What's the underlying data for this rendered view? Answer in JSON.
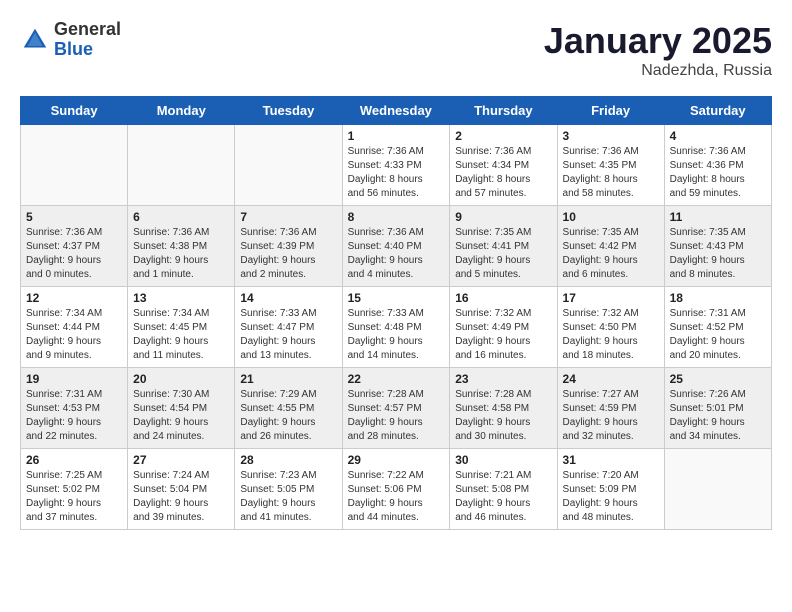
{
  "logo": {
    "general": "General",
    "blue": "Blue"
  },
  "title": "January 2025",
  "location": "Nadezhda, Russia",
  "days_of_week": [
    "Sunday",
    "Monday",
    "Tuesday",
    "Wednesday",
    "Thursday",
    "Friday",
    "Saturday"
  ],
  "weeks": [
    [
      {
        "day": "",
        "info": ""
      },
      {
        "day": "",
        "info": ""
      },
      {
        "day": "",
        "info": ""
      },
      {
        "day": "1",
        "info": "Sunrise: 7:36 AM\nSunset: 4:33 PM\nDaylight: 8 hours\nand 56 minutes."
      },
      {
        "day": "2",
        "info": "Sunrise: 7:36 AM\nSunset: 4:34 PM\nDaylight: 8 hours\nand 57 minutes."
      },
      {
        "day": "3",
        "info": "Sunrise: 7:36 AM\nSunset: 4:35 PM\nDaylight: 8 hours\nand 58 minutes."
      },
      {
        "day": "4",
        "info": "Sunrise: 7:36 AM\nSunset: 4:36 PM\nDaylight: 8 hours\nand 59 minutes."
      }
    ],
    [
      {
        "day": "5",
        "info": "Sunrise: 7:36 AM\nSunset: 4:37 PM\nDaylight: 9 hours\nand 0 minutes."
      },
      {
        "day": "6",
        "info": "Sunrise: 7:36 AM\nSunset: 4:38 PM\nDaylight: 9 hours\nand 1 minute."
      },
      {
        "day": "7",
        "info": "Sunrise: 7:36 AM\nSunset: 4:39 PM\nDaylight: 9 hours\nand 2 minutes."
      },
      {
        "day": "8",
        "info": "Sunrise: 7:36 AM\nSunset: 4:40 PM\nDaylight: 9 hours\nand 4 minutes."
      },
      {
        "day": "9",
        "info": "Sunrise: 7:35 AM\nSunset: 4:41 PM\nDaylight: 9 hours\nand 5 minutes."
      },
      {
        "day": "10",
        "info": "Sunrise: 7:35 AM\nSunset: 4:42 PM\nDaylight: 9 hours\nand 6 minutes."
      },
      {
        "day": "11",
        "info": "Sunrise: 7:35 AM\nSunset: 4:43 PM\nDaylight: 9 hours\nand 8 minutes."
      }
    ],
    [
      {
        "day": "12",
        "info": "Sunrise: 7:34 AM\nSunset: 4:44 PM\nDaylight: 9 hours\nand 9 minutes."
      },
      {
        "day": "13",
        "info": "Sunrise: 7:34 AM\nSunset: 4:45 PM\nDaylight: 9 hours\nand 11 minutes."
      },
      {
        "day": "14",
        "info": "Sunrise: 7:33 AM\nSunset: 4:47 PM\nDaylight: 9 hours\nand 13 minutes."
      },
      {
        "day": "15",
        "info": "Sunrise: 7:33 AM\nSunset: 4:48 PM\nDaylight: 9 hours\nand 14 minutes."
      },
      {
        "day": "16",
        "info": "Sunrise: 7:32 AM\nSunset: 4:49 PM\nDaylight: 9 hours\nand 16 minutes."
      },
      {
        "day": "17",
        "info": "Sunrise: 7:32 AM\nSunset: 4:50 PM\nDaylight: 9 hours\nand 18 minutes."
      },
      {
        "day": "18",
        "info": "Sunrise: 7:31 AM\nSunset: 4:52 PM\nDaylight: 9 hours\nand 20 minutes."
      }
    ],
    [
      {
        "day": "19",
        "info": "Sunrise: 7:31 AM\nSunset: 4:53 PM\nDaylight: 9 hours\nand 22 minutes."
      },
      {
        "day": "20",
        "info": "Sunrise: 7:30 AM\nSunset: 4:54 PM\nDaylight: 9 hours\nand 24 minutes."
      },
      {
        "day": "21",
        "info": "Sunrise: 7:29 AM\nSunset: 4:55 PM\nDaylight: 9 hours\nand 26 minutes."
      },
      {
        "day": "22",
        "info": "Sunrise: 7:28 AM\nSunset: 4:57 PM\nDaylight: 9 hours\nand 28 minutes."
      },
      {
        "day": "23",
        "info": "Sunrise: 7:28 AM\nSunset: 4:58 PM\nDaylight: 9 hours\nand 30 minutes."
      },
      {
        "day": "24",
        "info": "Sunrise: 7:27 AM\nSunset: 4:59 PM\nDaylight: 9 hours\nand 32 minutes."
      },
      {
        "day": "25",
        "info": "Sunrise: 7:26 AM\nSunset: 5:01 PM\nDaylight: 9 hours\nand 34 minutes."
      }
    ],
    [
      {
        "day": "26",
        "info": "Sunrise: 7:25 AM\nSunset: 5:02 PM\nDaylight: 9 hours\nand 37 minutes."
      },
      {
        "day": "27",
        "info": "Sunrise: 7:24 AM\nSunset: 5:04 PM\nDaylight: 9 hours\nand 39 minutes."
      },
      {
        "day": "28",
        "info": "Sunrise: 7:23 AM\nSunset: 5:05 PM\nDaylight: 9 hours\nand 41 minutes."
      },
      {
        "day": "29",
        "info": "Sunrise: 7:22 AM\nSunset: 5:06 PM\nDaylight: 9 hours\nand 44 minutes."
      },
      {
        "day": "30",
        "info": "Sunrise: 7:21 AM\nSunset: 5:08 PM\nDaylight: 9 hours\nand 46 minutes."
      },
      {
        "day": "31",
        "info": "Sunrise: 7:20 AM\nSunset: 5:09 PM\nDaylight: 9 hours\nand 48 minutes."
      },
      {
        "day": "",
        "info": ""
      }
    ]
  ]
}
